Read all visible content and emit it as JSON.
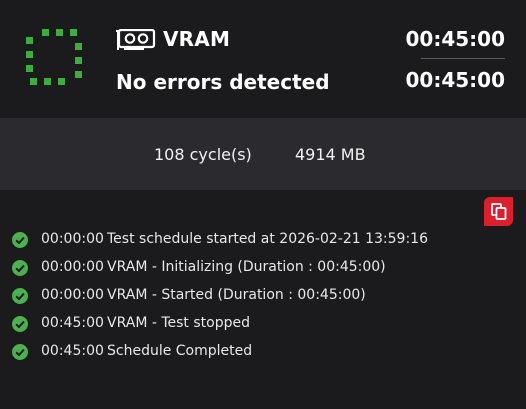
{
  "header": {
    "status_icon": "dotted-square-icon",
    "test_icon": "gpu-card-icon",
    "test_name": "VRAM",
    "result": "No errors detected",
    "elapsed_time": "00:45:00",
    "total_time": "00:45:00"
  },
  "stats": {
    "cycles": "108 cycle(s)",
    "memory": "4914 MB"
  },
  "copy_icon": "copy-icon",
  "colors": {
    "status_green": "#3dad3d",
    "check_green": "#4caf50",
    "copy_red": "#d9202c"
  },
  "log": [
    {
      "time": "00:00:00",
      "message": "Test schedule started at 2026-02-21 13:59:16"
    },
    {
      "time": "00:00:00",
      "message": "VRAM - Initializing (Duration : 00:45:00)"
    },
    {
      "time": "00:00:00",
      "message": "VRAM - Started (Duration : 00:45:00)"
    },
    {
      "time": "00:45:00",
      "message": "VRAM - Test stopped"
    },
    {
      "time": "00:45:00",
      "message": "Schedule Completed"
    }
  ]
}
